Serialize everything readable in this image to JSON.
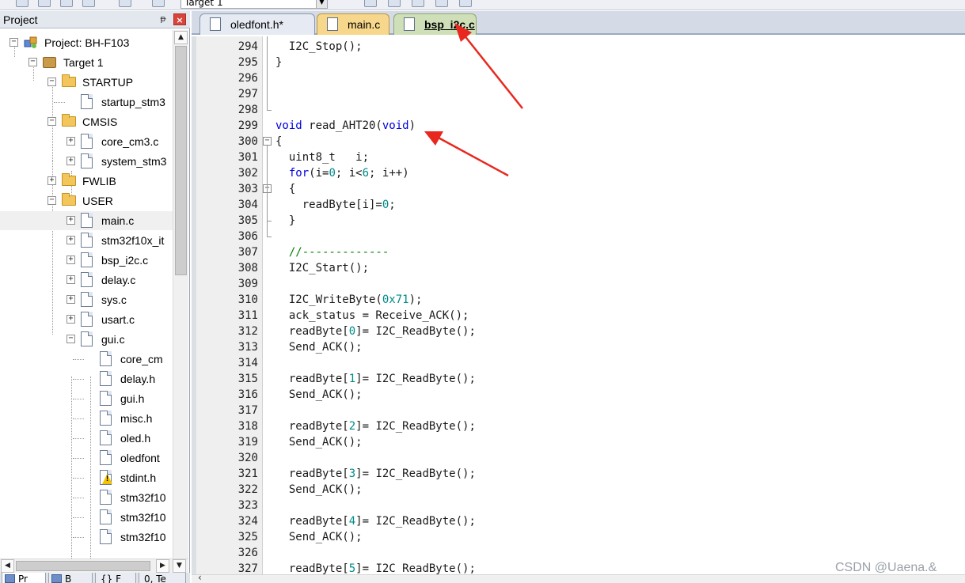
{
  "toolbar": {
    "target_combo": "Target 1"
  },
  "project_panel": {
    "title": "Project",
    "pin_glyph": "ᵽ",
    "close_glyph": "×",
    "tree": [
      {
        "label": "Project: BH-F103",
        "icon": "project-icon",
        "expander": "−"
      },
      {
        "label": "Target 1",
        "icon": "target-icon",
        "expander": "−"
      },
      {
        "label": "STARTUP",
        "icon": "folder-open-icon",
        "expander": "−"
      },
      {
        "label": "startup_stm3",
        "icon": "file-icon",
        "expander": ""
      },
      {
        "label": "CMSIS",
        "icon": "folder-open-icon",
        "expander": "−"
      },
      {
        "label": "core_cm3.c",
        "icon": "file-icon",
        "expander": "+"
      },
      {
        "label": "system_stm3",
        "icon": "file-icon",
        "expander": "+"
      },
      {
        "label": "FWLIB",
        "icon": "folder-icon",
        "expander": "+"
      },
      {
        "label": "USER",
        "icon": "folder-open-icon",
        "expander": "−"
      },
      {
        "label": "main.c",
        "icon": "file-icon",
        "expander": "+"
      },
      {
        "label": "stm32f10x_it",
        "icon": "file-icon",
        "expander": "+"
      },
      {
        "label": "bsp_i2c.c",
        "icon": "file-icon",
        "expander": "+"
      },
      {
        "label": "delay.c",
        "icon": "file-icon",
        "expander": "+"
      },
      {
        "label": "sys.c",
        "icon": "file-icon",
        "expander": "+"
      },
      {
        "label": "usart.c",
        "icon": "file-icon",
        "expander": "+"
      },
      {
        "label": "gui.c",
        "icon": "file-icon",
        "expander": "−"
      },
      {
        "label": "core_cm",
        "icon": "file-icon",
        "expander": ""
      },
      {
        "label": "delay.h",
        "icon": "file-icon",
        "expander": ""
      },
      {
        "label": "gui.h",
        "icon": "file-icon",
        "expander": ""
      },
      {
        "label": "misc.h",
        "icon": "file-icon",
        "expander": ""
      },
      {
        "label": "oled.h",
        "icon": "file-icon",
        "expander": ""
      },
      {
        "label": "oledfont",
        "icon": "file-icon",
        "expander": ""
      },
      {
        "label": "stdint.h",
        "icon": "warning-file-icon",
        "expander": ""
      },
      {
        "label": "stm32f10",
        "icon": "file-icon",
        "expander": ""
      },
      {
        "label": "stm32f10",
        "icon": "file-icon",
        "expander": ""
      },
      {
        "label": "stm32f10",
        "icon": "file-icon",
        "expander": ""
      }
    ],
    "bottom_tabs": [
      "Pr",
      "B",
      "{} F",
      "0, Te"
    ]
  },
  "editor": {
    "tabs": [
      {
        "label": "oledfont.h*"
      },
      {
        "label": "main.c"
      },
      {
        "label": "bsp_i2c.c"
      }
    ],
    "lines": [
      {
        "n": "294",
        "code": "  I2C_Stop();"
      },
      {
        "n": "295",
        "code": "}"
      },
      {
        "n": "296",
        "code": ""
      },
      {
        "n": "297",
        "code": ""
      },
      {
        "n": "298",
        "code": ""
      },
      {
        "n": "299",
        "code": "void read_AHT20(void)"
      },
      {
        "n": "300",
        "code": "{"
      },
      {
        "n": "301",
        "code": "  uint8_t   i;"
      },
      {
        "n": "302",
        "code": "  for(i=0; i<6; i++)"
      },
      {
        "n": "303",
        "code": "  {"
      },
      {
        "n": "304",
        "code": "    readByte[i]=0;"
      },
      {
        "n": "305",
        "code": "  }"
      },
      {
        "n": "306",
        "code": ""
      },
      {
        "n": "307",
        "code": "  //-------------"
      },
      {
        "n": "308",
        "code": "  I2C_Start();"
      },
      {
        "n": "309",
        "code": ""
      },
      {
        "n": "310",
        "code": "  I2C_WriteByte(0x71);"
      },
      {
        "n": "311",
        "code": "  ack_status = Receive_ACK();"
      },
      {
        "n": "312",
        "code": "  readByte[0]= I2C_ReadByte();"
      },
      {
        "n": "313",
        "code": "  Send_ACK();"
      },
      {
        "n": "314",
        "code": ""
      },
      {
        "n": "315",
        "code": "  readByte[1]= I2C_ReadByte();"
      },
      {
        "n": "316",
        "code": "  Send_ACK();"
      },
      {
        "n": "317",
        "code": ""
      },
      {
        "n": "318",
        "code": "  readByte[2]= I2C_ReadByte();"
      },
      {
        "n": "319",
        "code": "  Send_ACK();"
      },
      {
        "n": "320",
        "code": ""
      },
      {
        "n": "321",
        "code": "  readByte[3]= I2C_ReadByte();"
      },
      {
        "n": "322",
        "code": "  Send_ACK();"
      },
      {
        "n": "323",
        "code": ""
      },
      {
        "n": "324",
        "code": "  readByte[4]= I2C_ReadByte();"
      },
      {
        "n": "325",
        "code": "  Send_ACK();"
      },
      {
        "n": "326",
        "code": ""
      },
      {
        "n": "327",
        "code": "  readByte[5]= I2C_ReadByte();"
      }
    ],
    "fold_markers": {
      "300": "−",
      "303": "−"
    }
  },
  "watermark": "CSDN @Uaena.&",
  "colors": {
    "keyword": "#0000e0",
    "number": "#008a8a",
    "comment": "#008000",
    "annotation_arrow": "#e8281e"
  }
}
